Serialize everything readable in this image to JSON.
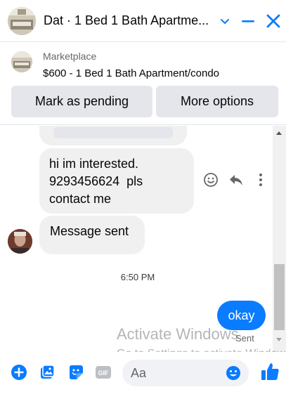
{
  "header": {
    "title": "Dat · 1 Bed 1 Bath Apartme..."
  },
  "marketplace": {
    "label": "Marketplace",
    "listing": "$600 - 1 Bed 1 Bath Apartment/condo",
    "mark_pending_label": "Mark as pending",
    "more_options_label": "More options"
  },
  "conversation": {
    "incoming": [
      {
        "lines": [
          "hi im interested.",
          "9293456624  pls",
          "contact me"
        ]
      },
      {
        "text": "Message sent"
      }
    ],
    "timestamp": "6:50 PM",
    "outgoing": {
      "text": "okay",
      "status": "Sent"
    }
  },
  "watermark": {
    "line1": "Activate Windows",
    "line2": "Go to Settings to activate Windows."
  },
  "composer": {
    "placeholder": "Aa"
  },
  "icons": {
    "chevron": "chevron-down-icon",
    "minimize": "minimize-icon",
    "close": "close-icon",
    "react": "smiley-icon",
    "reply": "reply-icon",
    "more": "more-vertical-icon",
    "add": "plus-circle-icon",
    "photo": "photo-icon",
    "sticker": "sticker-icon",
    "gif": "gif-icon",
    "emoji": "emoji-icon",
    "like": "thumbs-up-icon"
  },
  "colors": {
    "accent": "#0a7cff",
    "bubble_in": "#f0f0f0",
    "button_bg": "#e4e6eb"
  }
}
